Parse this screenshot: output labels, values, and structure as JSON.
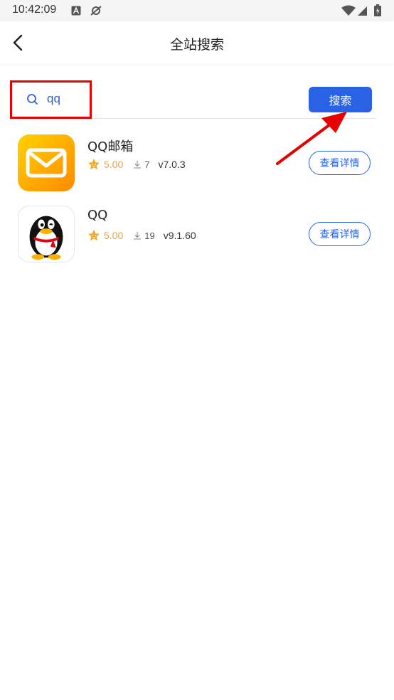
{
  "status_bar": {
    "time": "10:42:09"
  },
  "header": {
    "title": "全站搜索"
  },
  "search": {
    "query": "qq",
    "button_label": "搜索"
  },
  "results": [
    {
      "name": "QQ邮箱",
      "rating": "5.00",
      "downloads": "7",
      "version": "v7.0.3",
      "action_label": "查看详情",
      "icon": "mail-icon"
    },
    {
      "name": "QQ",
      "rating": "5.00",
      "downloads": "19",
      "version": "v9.1.60",
      "action_label": "查看详情",
      "icon": "penguin-icon"
    }
  ],
  "colors": {
    "accent": "#2a62e6",
    "rating": "#f0a23b",
    "highlight": "#e60000"
  }
}
